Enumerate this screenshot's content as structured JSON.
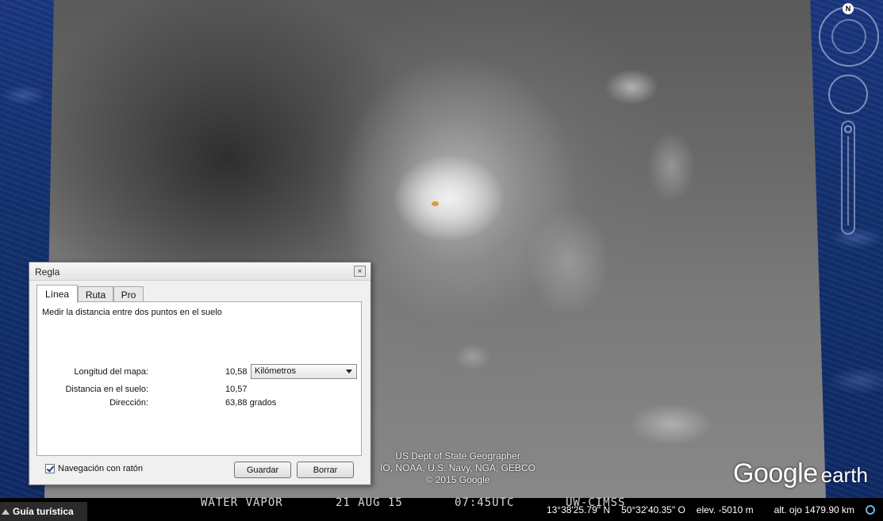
{
  "satellite": {
    "product": "WATER VAPOR",
    "date": "21 AUG 15",
    "time": "07:45UTC",
    "source": "UW-CIMSS"
  },
  "attribution": [
    "US Dept of State Geographer",
    "IO, NOAA, U.S. Navy, NGA, GEBCO",
    "© 2015 Google"
  ],
  "logo": {
    "google": "Google",
    "earth": "earth"
  },
  "status": {
    "tour_guide": "Guía turística",
    "lat": "13°38'25.79\" N",
    "lon": "50°32'40.35\" O",
    "elev": "elev. -5010 m",
    "eye_alt": "alt. ojo 1479.90 km"
  },
  "nav": {
    "north": "N"
  },
  "ruler": {
    "title": "Regla",
    "close": "×",
    "tabs": [
      "Línea",
      "Ruta",
      "Pro"
    ],
    "description": "Medir la distancia entre dos puntos en el suelo",
    "map_length_label": "Longitud del mapa:",
    "map_length_value": "10,58",
    "unit": "Kilómetros",
    "ground_distance_label": "Distancia en el suelo:",
    "ground_distance_value": "10,57",
    "heading_label": "Dirección:",
    "heading_value": "63,88 grados",
    "mouse_nav_label": "Navegación con ratón",
    "mouse_nav_checked": true,
    "save_label": "Guardar",
    "clear_label": "Borrar"
  }
}
